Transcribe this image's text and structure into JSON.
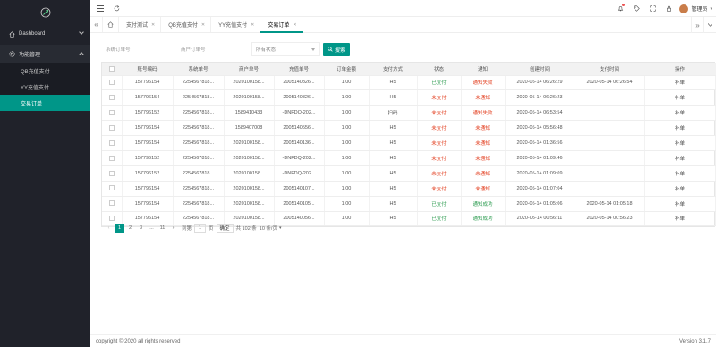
{
  "sidebar": {
    "items": [
      {
        "label": "Dashboard",
        "icon": "home-icon"
      },
      {
        "label": "功能管理",
        "icon": "gear-icon"
      }
    ],
    "sub_items": [
      {
        "label": "QB充值支付"
      },
      {
        "label": "YY充值支付"
      },
      {
        "label": "交易订单"
      }
    ]
  },
  "header": {
    "user": "管理员",
    "user_caret": "▾"
  },
  "tabs": [
    {
      "label": "支付测试"
    },
    {
      "label": "QB充值支付"
    },
    {
      "label": "YY充值支付"
    },
    {
      "label": "交易订单"
    }
  ],
  "search": {
    "system_order_placeholder": "系统订单号",
    "merchant_order_placeholder": "商户订单号",
    "status_placeholder": "所有状态",
    "search_label": "搜索"
  },
  "table": {
    "columns": [
      "",
      "账号编码",
      "系统单号",
      "商户单号",
      "充值单号",
      "订单金额",
      "支付方式",
      "状态",
      "通知",
      "创建时间",
      "支付时间",
      "操作"
    ],
    "rows": [
      [
        "157796154",
        "22545678​18...",
        "2020100158...",
        "2005140826...",
        "1.00",
        "H5",
        "已支付",
        "通知失败",
        "2020-05-14 06:26:29",
        "2020-05-14 06:26:54",
        "补单"
      ],
      [
        "157796154",
        "22545678​18...",
        "2020100158...",
        "2005140826...",
        "1.00",
        "H5",
        "未支付",
        "未通知",
        "2020-05-14 06:26:23",
        "",
        "补单"
      ],
      [
        "157796152",
        "22545678​18...",
        "1589410433",
        "-DNFDQ-202...",
        "1.00",
        "扫码",
        "未支付",
        "通知失败",
        "2020-05-14 06:53:54",
        "",
        "补单"
      ],
      [
        "157796154",
        "22545678​18...",
        "1589407008",
        "2005140556...",
        "1.00",
        "H5",
        "未支付",
        "未通知",
        "2020-05-14 05:56:48",
        "",
        "补单"
      ],
      [
        "157796154",
        "22545678​18...",
        "2020100158...",
        "2005140136...",
        "1.00",
        "H5",
        "未支付",
        "未通知",
        "2020-05-14 01:36:56",
        "",
        "补单"
      ],
      [
        "157796152",
        "22545678​18...",
        "2020100158...",
        "-DNFDQ-202...",
        "1.00",
        "H5",
        "未支付",
        "未通知",
        "2020-05-14 01:09:46",
        "",
        "补单"
      ],
      [
        "157796152",
        "22545678​18...",
        "2020100158...",
        "-DNFDQ-202...",
        "1.00",
        "H5",
        "未支付",
        "未通知",
        "2020-05-14 01:09:09",
        "",
        "补单"
      ],
      [
        "157796154",
        "22545678​18...",
        "2020100158...",
        "2005140107...",
        "1.00",
        "H5",
        "未支付",
        "未通知",
        "2020-05-14 01:07:04",
        "",
        "补单"
      ],
      [
        "157796154",
        "22545678​18...",
        "2020100158...",
        "2005140105...",
        "1.00",
        "H5",
        "已支付",
        "通知成功",
        "2020-05-14 01:05:06",
        "2020-05-14 01:05:18",
        "补单"
      ],
      [
        "157796154",
        "22545678​18...",
        "2020100158...",
        "2005140056...",
        "1.00",
        "H5",
        "已支付",
        "通知成功",
        "2020-05-14 00:56:11",
        "2020-05-14 00:56:23",
        "补单"
      ]
    ]
  },
  "pager": {
    "prev": "‹",
    "pages": [
      "1",
      "2",
      "3",
      "...",
      "11"
    ],
    "next": "›",
    "goto": "到第",
    "goto_value": "1",
    "goto_unit": "页",
    "confirm": "确定",
    "total": "共 102 条",
    "per_page": "10 条/页"
  },
  "footer": {
    "copyright": "copyright © 2020 all rights reserved",
    "version": "Version 3.1.7"
  },
  "colors": {
    "accent": "#009688",
    "sidebar": "#20222a",
    "paid": "#2b9b4f",
    "unpaid": "#e23c1c"
  }
}
